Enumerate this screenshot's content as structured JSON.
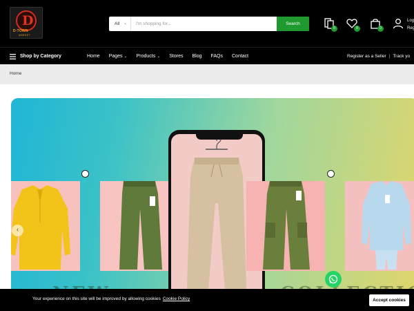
{
  "header": {
    "logo": {
      "brand": "D-TOWN",
      "sub": "MARKET"
    },
    "search": {
      "category": "All",
      "placeholder": "I'm shopping for...",
      "button_label": "Search"
    },
    "icons": [
      "compare-icon",
      "heart-icon",
      "bag-icon",
      "user-icon"
    ],
    "badges": {
      "compare": "0",
      "wishlist": "0",
      "cart": "0"
    },
    "login_line1": "Log",
    "login_line2": "Reg"
  },
  "nav": {
    "category_label": "Shop by Category",
    "items": [
      {
        "label": "Home",
        "dropdown": false
      },
      {
        "label": "Pages",
        "dropdown": true
      },
      {
        "label": "Products",
        "dropdown": true
      },
      {
        "label": "Stores",
        "dropdown": false
      },
      {
        "label": "Blog",
        "dropdown": false
      },
      {
        "label": "FAQs",
        "dropdown": false
      },
      {
        "label": "Contact",
        "dropdown": false
      }
    ],
    "register_seller": "Register as a Seller",
    "separator": "|",
    "track": "Track yo"
  },
  "breadcrumb": {
    "home": "Home"
  },
  "banner": {
    "products": [
      "yellow kurta",
      "olive chino pants",
      "beige drawstring trousers",
      "olive cargo pants",
      "light blue kurta set"
    ],
    "colors": {
      "yellow": "#f2c318",
      "olive": "#5f7a3a",
      "beige": "#d5c1a1",
      "blue": "#b8d8ee"
    }
  },
  "cookie": {
    "message": "Your experience on this site will be improved by allowing cookies",
    "link": "Cookie Policy",
    "accept": "Accept cookies"
  },
  "colors": {
    "accent": "#1f9a2f",
    "header_bg": "#000000",
    "whatsapp": "#25d366"
  }
}
